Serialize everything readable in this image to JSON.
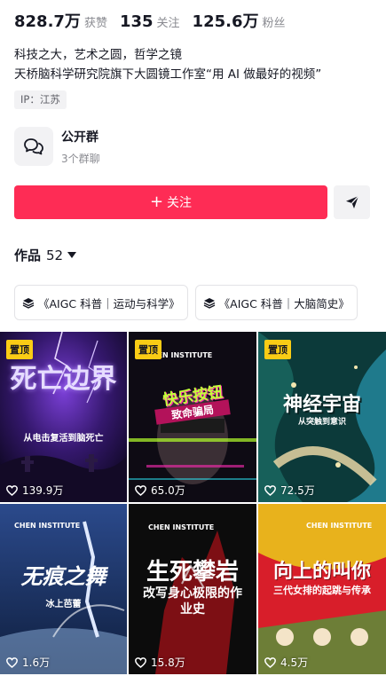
{
  "stats": [
    {
      "value": "828.7万",
      "label": "获赞"
    },
    {
      "value": "135",
      "label": "关注"
    },
    {
      "value": "125.6万",
      "label": "粉丝"
    }
  ],
  "bio": {
    "line1": "科技之大，艺术之圆，哲学之镜",
    "line2": "天桥脑科学研究院旗下大圆镜工作室“用 AI 做最好的视频”"
  },
  "ip_tag": "IP：江苏",
  "group": {
    "title": "公开群",
    "subtitle": "3个群聊",
    "icon": "chat-bubbles-icon"
  },
  "follow_button": {
    "label": "关注",
    "plus": "+"
  },
  "share_icon": "send-icon",
  "works": {
    "label": "作品",
    "count": "52"
  },
  "collections": [
    {
      "label": "《AIGC 科普｜运动与科学》",
      "icon": "layers-icon"
    },
    {
      "label": "《AIGC 科普｜大脑简史》",
      "icon": "layers-icon"
    }
  ],
  "videos": [
    {
      "pinned": "置顶",
      "likes": "139.9万",
      "title": "死亡边界",
      "subtitle": "从电击复活到脑死亡",
      "brand": ""
    },
    {
      "pinned": "置顶",
      "likes": "65.0万",
      "title": "快乐按钮",
      "subtitle": "致命骗局",
      "brand": "CHEN INSTITUTE"
    },
    {
      "pinned": "置顶",
      "likes": "72.5万",
      "title": "神经宇宙",
      "subtitle": "从突触到意识",
      "brand": ""
    },
    {
      "pinned": "",
      "likes": "1.6万",
      "title": "无痕之舞",
      "subtitle": "冰上芭蕾",
      "brand": "CHEN INSTITUTE"
    },
    {
      "pinned": "",
      "likes": "15.8万",
      "title": "生死攀岩",
      "subtitle": "改写身心极限的作业史",
      "brand": "CHEN INSTITUTE"
    },
    {
      "pinned": "",
      "likes": "4.5万",
      "title": "向上的叫你",
      "subtitle": "三代女排的起跳与传承",
      "brand": "CHEN INSTITUTE"
    }
  ],
  "colors": {
    "accent": "#fe2c55",
    "pin": "#facc15"
  }
}
